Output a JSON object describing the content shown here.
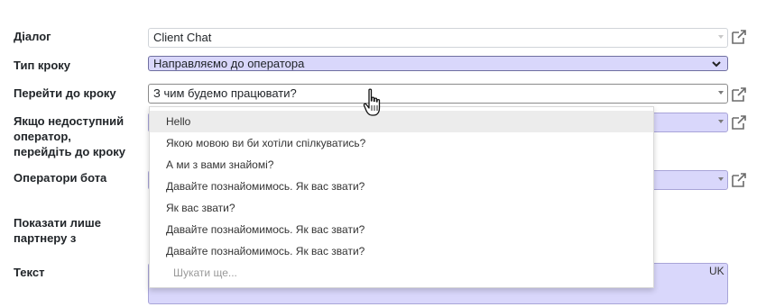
{
  "labels": {
    "dialog": "Діалог",
    "step_type": "Тип кроку",
    "go_to_step": "Перейти до кроку",
    "if_unavailable_1": "Якщо недоступний",
    "if_unavailable_2": "оператор,",
    "if_unavailable_3": "перейдіть до кроку",
    "bot_operators": "Оператори бота",
    "show_only_1": "Показати лише",
    "show_only_2": "партнеру з",
    "text": "Текст"
  },
  "fields": {
    "dialog_value": "Client Chat",
    "step_type_value": "Направляємо до оператора",
    "go_to_step_value": "З чим будемо працювати?"
  },
  "dropdown": {
    "items": [
      "Hello",
      "Якою мовою ви би хотіли спілкуватись?",
      "А ми з вами знайомі?",
      "Давайте познайомимось. Як вас звати?",
      "Як вас звати?",
      "Давайте познайомимось. Як вас звати?",
      "Давайте познайомимось. Як вас звати?"
    ],
    "search_more": "Шукати ще..."
  },
  "text_field": {
    "lang": "UK"
  },
  "colors": {
    "selection": "#d9d7fb",
    "border": "#d0d4d9"
  },
  "icons": [
    "external-link-icon",
    "chevron-down-icon",
    "caret-down-icon",
    "hand-cursor-icon"
  ]
}
